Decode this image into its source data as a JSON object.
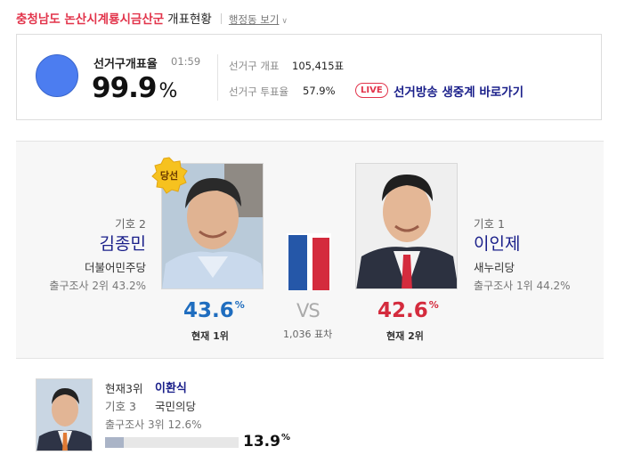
{
  "header": {
    "region": "충청남도 논산시계룡시금산군",
    "status": "개표현황",
    "admin_link": "행정동 보기"
  },
  "summary": {
    "count_rate_label": "선거구개표율",
    "time": "01:59",
    "count_rate_value": "99.9",
    "count_rate_unit": "%",
    "count_rate_fraction": 0.999,
    "ballots_counted_label": "선거구 개표",
    "ballots_counted_value": "105,415표",
    "turnout_label": "선거구 투표율",
    "turnout_value": "57.9%",
    "live_badge": "LIVE",
    "live_link": "선거방송 생중계 바로가기"
  },
  "candidates": {
    "left": {
      "number": "기호 2",
      "name": "김종민",
      "party": "더불어민주당",
      "exit_poll": "출구조사 2위 43.2%",
      "percent": "43.6",
      "percent_unit": "%",
      "rank": "현재 1위",
      "winner_badge": "당선",
      "color": "#1f6dbf"
    },
    "right": {
      "number": "기호 1",
      "name": "이인제",
      "party": "새누리당",
      "exit_poll": "출구조사 1위 44.2%",
      "percent": "42.6",
      "percent_unit": "%",
      "rank": "현재 2위",
      "color": "#d42b3d"
    },
    "vs_label": "VS",
    "gap": "1,036 표차"
  },
  "third": {
    "rank": "현재3위",
    "name": "이환식",
    "number": "기호 3",
    "party": "국민의당",
    "exit_poll": "출구조사 3위 12.6%",
    "percent": "13.9",
    "percent_unit": "%",
    "bar_fraction": 0.139
  },
  "icons": [
    "winner-badge-icon",
    "vs-bar-icon",
    "count-pie-icon"
  ],
  "colors": {
    "region_red": "#e2344b",
    "name_navy": "#1a1f8a",
    "pie_blue": "#4c7df0",
    "bar_blue": "#2557a8",
    "bar_red": "#d42b3d"
  }
}
